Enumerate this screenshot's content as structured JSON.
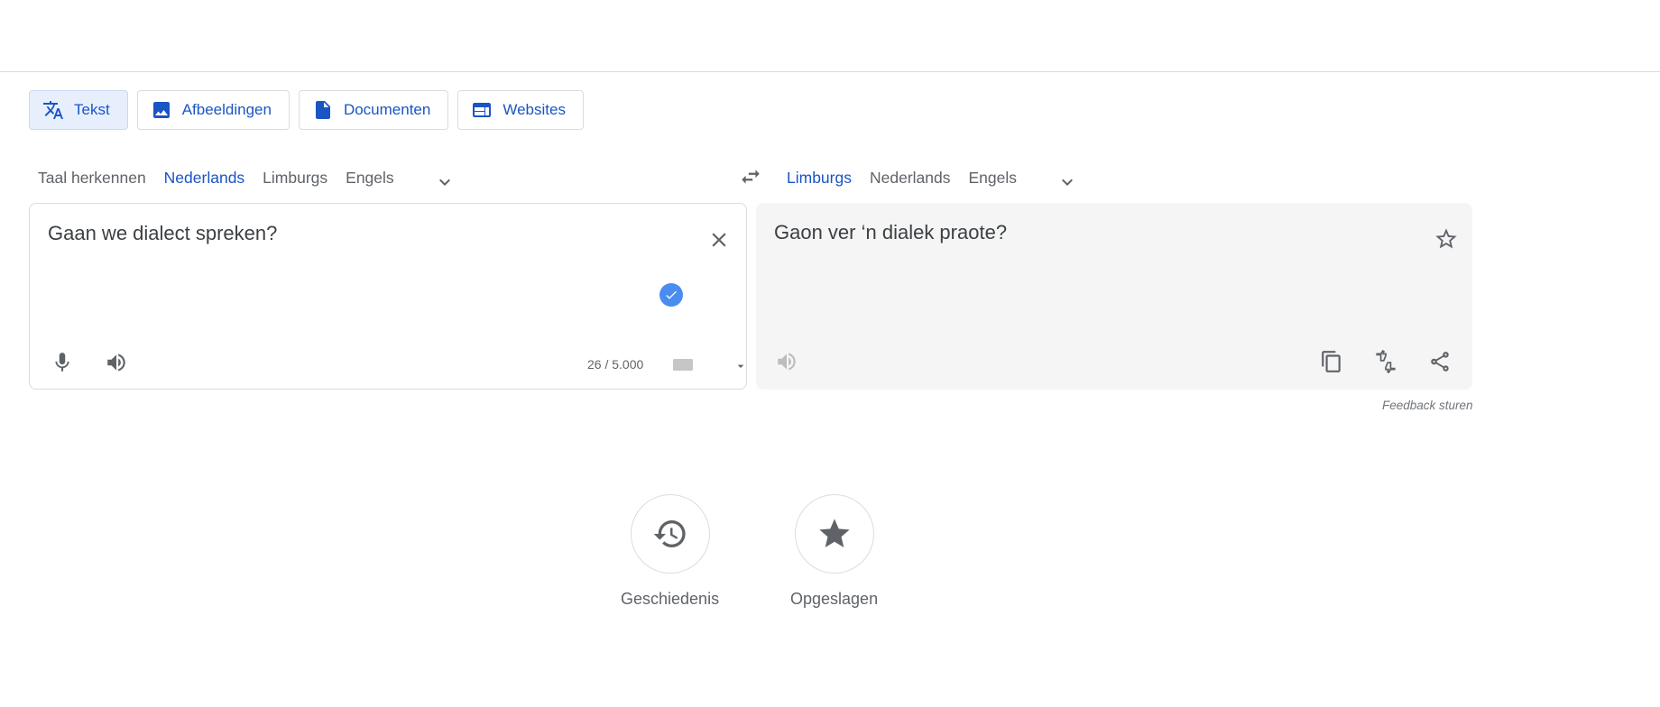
{
  "mode_tabs": [
    {
      "label": "Tekst",
      "icon": "translate-icon",
      "active": true
    },
    {
      "label": "Afbeeldingen",
      "icon": "image-icon",
      "active": false
    },
    {
      "label": "Documenten",
      "icon": "document-icon",
      "active": false
    },
    {
      "label": "Websites",
      "icon": "website-icon",
      "active": false
    }
  ],
  "source_langs": [
    {
      "label": "Taal herkennen",
      "active": false
    },
    {
      "label": "Nederlands",
      "active": true
    },
    {
      "label": "Limburgs",
      "active": false
    },
    {
      "label": "Engels",
      "active": false
    }
  ],
  "target_langs": [
    {
      "label": "Limburgs",
      "active": true
    },
    {
      "label": "Nederlands",
      "active": false
    },
    {
      "label": "Engels",
      "active": false
    }
  ],
  "source": {
    "text": "Gaan we dialect spreken?",
    "char_count": "26 / 5.000"
  },
  "target": {
    "text": "Gaon ver ‘n dialek praote?"
  },
  "feedback_label": "Feedback sturen",
  "bottom_actions": [
    {
      "label": "Geschiedenis",
      "icon": "history-icon"
    },
    {
      "label": "Opgeslagen",
      "icon": "star-filled-icon"
    }
  ],
  "colors": {
    "accent": "#1a55c4",
    "active_tab_bg": "#e8effc",
    "target_bg": "#f5f5f5",
    "check_badge": "#4a8cf0"
  }
}
